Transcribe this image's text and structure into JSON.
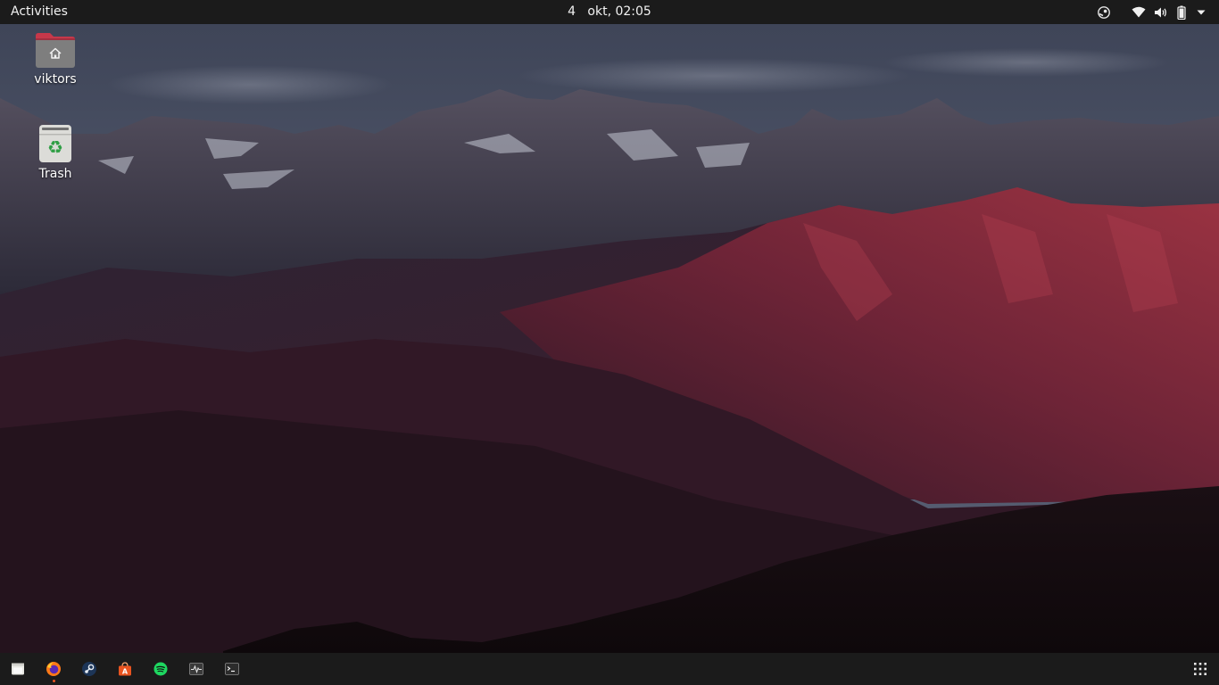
{
  "topbar": {
    "activities_label": "Activities",
    "clock_day": "4",
    "clock_rest": "okt, 02:05",
    "tray_icons": [
      "steam-tray-icon",
      "wifi-icon",
      "volume-icon",
      "battery-icon",
      "system-menu-arrow-icon"
    ]
  },
  "desktop": {
    "icons": [
      {
        "label": "viktors",
        "icon": "home-folder-icon"
      },
      {
        "label": "Trash",
        "icon": "trash-icon"
      }
    ]
  },
  "dock": {
    "items": [
      "files-icon",
      "firefox-icon",
      "steam-icon",
      "software-center-icon",
      "spotify-icon",
      "system-monitor-icon",
      "terminal-icon"
    ],
    "running": [
      "firefox-icon"
    ],
    "show_apps_icon": "show-applications-icon"
  },
  "colors": {
    "panel": "#1b1b1b",
    "ubuntu_orange": "#e95420",
    "folder_red": "#c7384a",
    "spotify_green": "#1ed760"
  }
}
